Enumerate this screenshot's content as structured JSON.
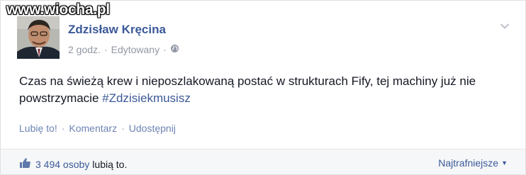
{
  "watermark": "www.wiocha.pl",
  "post": {
    "author": "Zdzisław Kręcina",
    "time": "2 godz.",
    "edited": "Edytowany",
    "body": "Czas na świeżą krew i nieposzlakowaną postać w strukturach Fify, tej machiny już nie powstrzymacie ",
    "hashtag": "#Zdzisiekmusisz"
  },
  "actions": {
    "like": "Lubię to!",
    "comment": "Komentarz",
    "share": "Udostępnij"
  },
  "footer": {
    "like_count": "3 494 osoby",
    "like_text": "lubią to.",
    "sort_label": "Najtrafniejsze"
  },
  "icons": [
    "globe-icon",
    "chevron-down-icon",
    "thumbs-up-icon",
    "caret-down-icon"
  ],
  "colors": {
    "link": "#3b5998",
    "muted": "#9197a3",
    "action": "#6d84b4"
  }
}
